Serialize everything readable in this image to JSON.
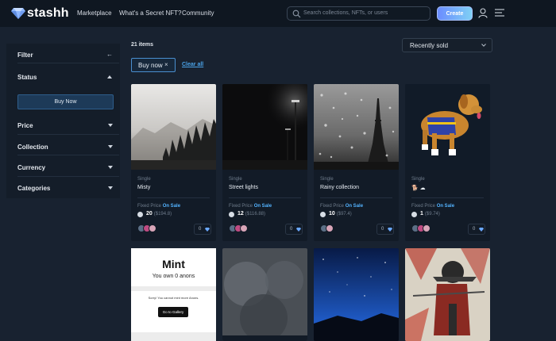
{
  "app": {
    "name": "stashh",
    "colors": {
      "background": "#182230",
      "topbar": "#0f1721",
      "accent": "#53b3ff",
      "create_gradient": [
        "#6b8cff",
        "#7fd0f5"
      ]
    }
  },
  "nav": {
    "items": [
      "Marketplace",
      "What's a Secret NFT?",
      "Community"
    ],
    "search_placeholder": "Search collections, NFTs, or users",
    "create_label": "Create",
    "icons": [
      "user-icon",
      "menu-icon"
    ]
  },
  "sidebar": {
    "filter_label": "Filter",
    "status_label": "Status",
    "buy_now_label": "Buy Now",
    "sections": [
      "Price",
      "Collection",
      "Currency",
      "Categories"
    ]
  },
  "main": {
    "items_count": "21 items",
    "sort_value": "Recently sold",
    "chip_label": "Buy now",
    "chip_close": "×",
    "clear_all": "Clear all"
  },
  "cards": [
    {
      "type": "Single",
      "name": "Misty",
      "pricing": "Fixed Price",
      "status": "On Sale",
      "price": "20",
      "usd": "($194.8)",
      "likes": "0"
    },
    {
      "type": "Single",
      "name": "Street lights",
      "pricing": "Fixed Price",
      "status": "On Sale",
      "price": "12",
      "usd": "($116.88)",
      "likes": "0"
    },
    {
      "type": "Single",
      "name": "Rainy collection",
      "pricing": "Fixed Price",
      "status": "On Sale",
      "price": "10",
      "usd": "($97.4)",
      "likes": "0"
    },
    {
      "type": "Single",
      "name": "🐕 ☁",
      "pricing": "Fixed Price",
      "status": "On Sale",
      "price": "1",
      "usd": "($9.74)",
      "likes": "0"
    }
  ],
  "mint_card": {
    "title": "Mint",
    "owned": "You own 0 anons",
    "sorry": "Sorry! You cannot mint more Anons.",
    "button": "Go to Gallery"
  }
}
